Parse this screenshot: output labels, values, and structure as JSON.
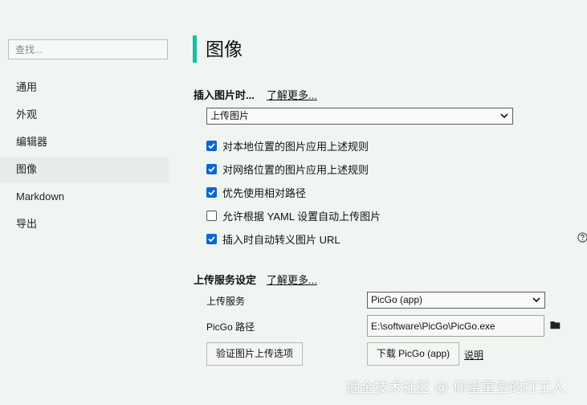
{
  "sidebar": {
    "search_placeholder": "查找...",
    "items": [
      {
        "label": "通用"
      },
      {
        "label": "外观"
      },
      {
        "label": "编辑器"
      },
      {
        "label": "图像",
        "active": true
      },
      {
        "label": "Markdown"
      },
      {
        "label": "导出"
      }
    ]
  },
  "page": {
    "title": "图像",
    "accent_color": "#16bfa6"
  },
  "insert_section": {
    "title": "插入图片时...",
    "learn_more": "了解更多...",
    "action_select": "上传图片",
    "options": [
      {
        "label": "对本地位置的图片应用上述规则",
        "checked": true
      },
      {
        "label": "对网络位置的图片应用上述规则",
        "checked": true
      },
      {
        "label": "优先使用相对路径",
        "checked": true
      },
      {
        "label": "允许根据 YAML 设置自动上传图片",
        "checked": false
      },
      {
        "label": "插入时自动转义图片 URL",
        "checked": true
      }
    ],
    "help_icon": "question-circle-icon"
  },
  "upload_section": {
    "title": "上传服务设定",
    "learn_more": "了解更多...",
    "service_label": "上传服务",
    "service_value": "PicGo (app)",
    "path_label": "PicGo 路径",
    "path_value": "E:\\software\\PicGo\\PicGo.exe",
    "verify_button": "验证图片上传选项",
    "download_button": "下载 PicGo (app)",
    "explain_link": "说明"
  },
  "watermark": "掘金技术社区 @ 仰望星空的打工人"
}
